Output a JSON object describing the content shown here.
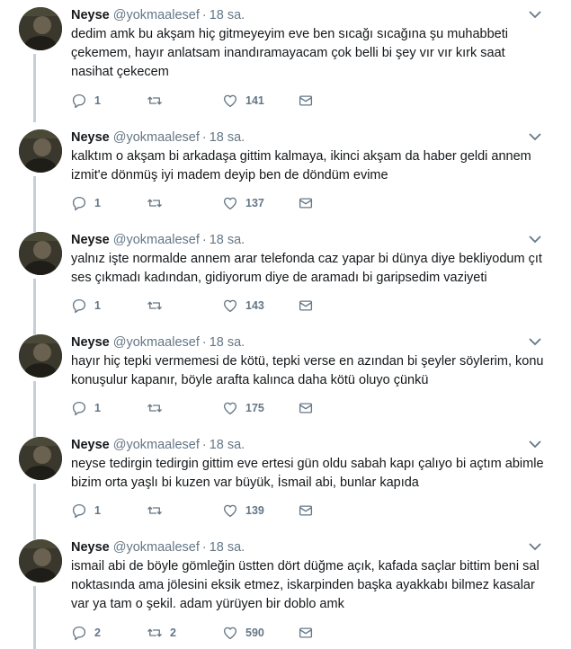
{
  "tweets": [
    {
      "name": "Neyse",
      "handle": "@yokmaalesef",
      "separator": "·",
      "time": "18 sa.",
      "text": "dedim amk bu akşam hiç gitmeyeyim eve ben sıcağı sıcağına şu muhabbeti çekemem, hayır anlatsam inandıramayacam çok belli bi şey vır vır kırk saat nasihat çekecem",
      "replies": "1",
      "retweets": "",
      "likes": "141"
    },
    {
      "name": "Neyse",
      "handle": "@yokmaalesef",
      "separator": "·",
      "time": "18 sa.",
      "text": "kalktım o akşam bi arkadaşa gittim kalmaya, ikinci akşam da haber geldi annem izmit'e dönmüş iyi madem deyip ben de döndüm evime",
      "replies": "1",
      "retweets": "",
      "likes": "137"
    },
    {
      "name": "Neyse",
      "handle": "@yokmaalesef",
      "separator": "·",
      "time": "18 sa.",
      "text": "yalnız işte normalde annem arar telefonda caz yapar bi dünya diye bekliyodum çıt ses çıkmadı kadından, gidiyorum diye de aramadı bi garipsedim vaziyeti",
      "replies": "1",
      "retweets": "",
      "likes": "143"
    },
    {
      "name": "Neyse",
      "handle": "@yokmaalesef",
      "separator": "·",
      "time": "18 sa.",
      "text": "hayır hiç tepki vermemesi de kötü, tepki verse en azından bi şeyler söylerim, konu konuşulur kapanır, böyle arafta kalınca daha kötü oluyo çünkü",
      "replies": "1",
      "retweets": "",
      "likes": "175"
    },
    {
      "name": "Neyse",
      "handle": "@yokmaalesef",
      "separator": "·",
      "time": "18 sa.",
      "text": "neyse tedirgin tedirgin gittim eve ertesi gün oldu sabah kapı çalıyo bi açtım abimle bizim orta yaşlı bi kuzen var büyük, İsmail abi, bunlar kapıda",
      "replies": "1",
      "retweets": "",
      "likes": "139"
    },
    {
      "name": "Neyse",
      "handle": "@yokmaalesef",
      "separator": "·",
      "time": "18 sa.",
      "text": "ismail abi de böyle gömleğin üstten dört düğme açık, kafada saçlar bittim beni sal noktasında ama jölesini eksik etmez, iskarpinden başka ayakkabı bilmez kasalar var ya tam o şekil. adam yürüyen bir doblo amk",
      "replies": "2",
      "retweets": "2",
      "likes": "590"
    }
  ],
  "icons": {
    "reply": "reply-icon",
    "retweet": "retweet-icon",
    "like": "heart-icon",
    "dm": "envelope-icon",
    "caret": "chevron-down-icon"
  },
  "colors": {
    "icon": "#657786",
    "thread_line": "#c4cfd6",
    "text": "#14171a"
  }
}
